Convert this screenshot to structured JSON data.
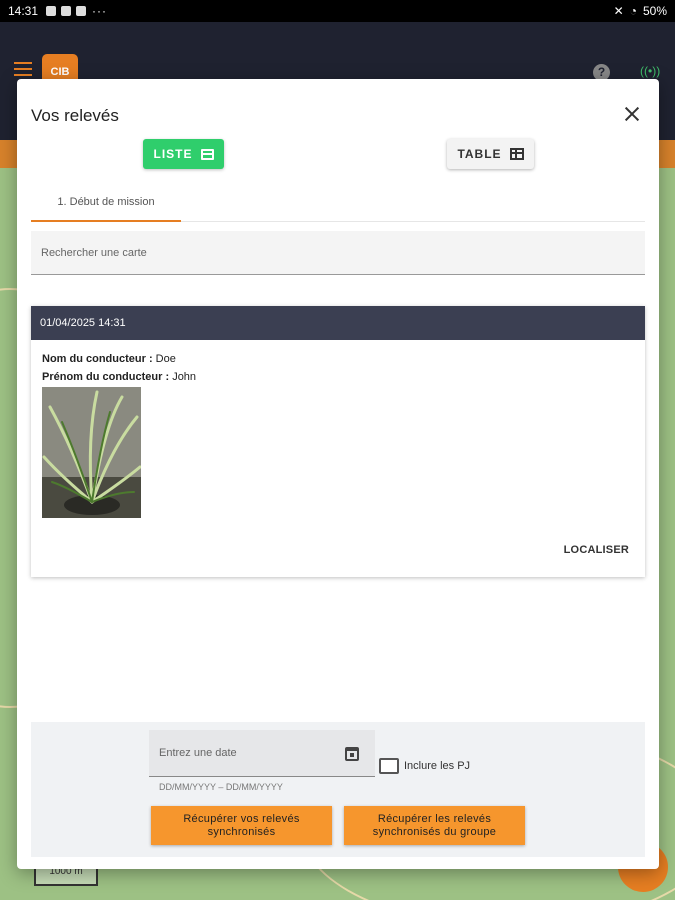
{
  "status_bar": {
    "time": "14:31",
    "dots": "···",
    "battery": "50%"
  },
  "app": {
    "logo_text": "CIB",
    "help_icon": "question-icon",
    "signal_icon": "broadcast-icon",
    "map_scale": "1000 m"
  },
  "modal": {
    "title": "Vos relevés",
    "view_buttons": {
      "liste": "LISTE",
      "table": "TABLE"
    },
    "tabs": [
      "1. Début de mission"
    ],
    "search": {
      "placeholder": "Rechercher une carte"
    },
    "card": {
      "header": "01/04/2025 14:31",
      "fields": [
        {
          "label": "Nom du conducteur :",
          "value": "Doe"
        },
        {
          "label": "Prénom du conducteur :",
          "value": "John"
        }
      ],
      "action": "LOCALISER"
    },
    "footer": {
      "date_placeholder": "Entrez une date",
      "date_hint": "DD/MM/YYYY – DD/MM/YYYY",
      "include_label": "Inclure les PJ",
      "btn_own": "Récupérer vos relevés synchronisés",
      "btn_group": "Récupérer les relevés synchronisés du groupe"
    }
  },
  "colors": {
    "accent": "#e67e22",
    "liste_green": "#2fce6c",
    "card_header": "#3b3f52",
    "orange_button": "#f6962d"
  }
}
